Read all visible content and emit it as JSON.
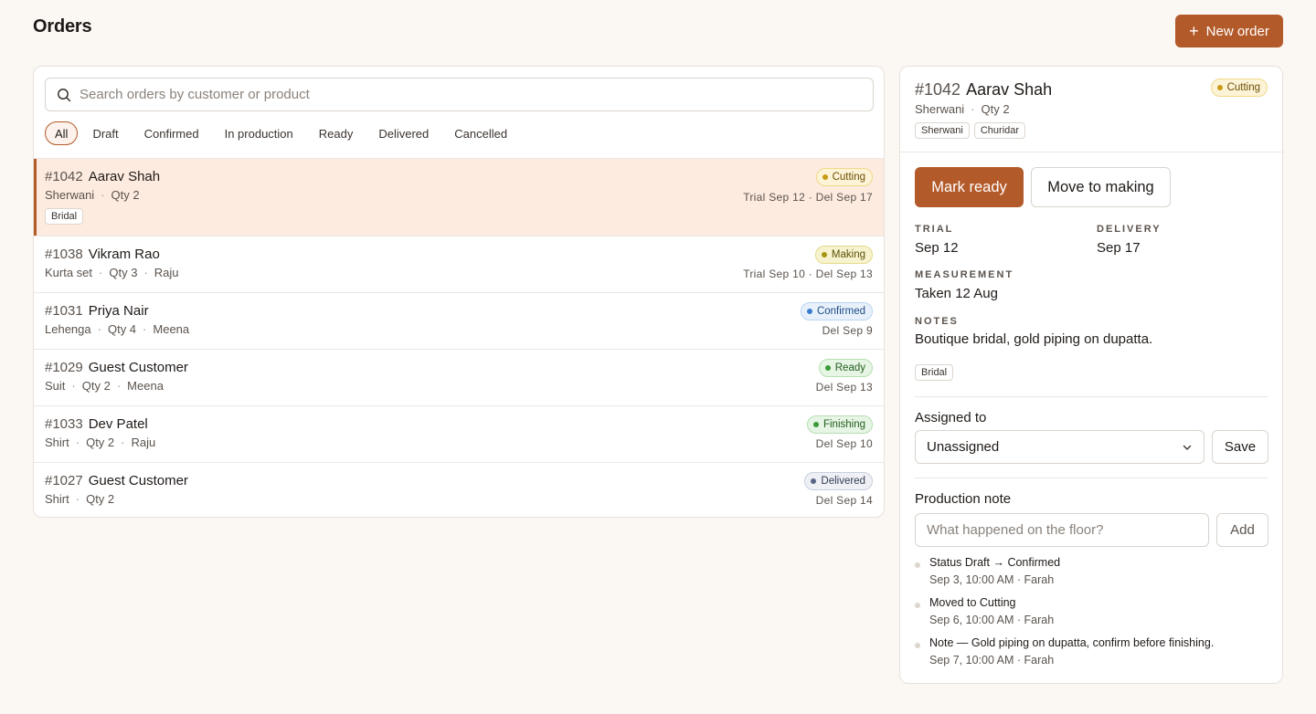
{
  "header": {
    "title": "Orders",
    "new_order_label": "New order"
  },
  "search": {
    "placeholder": "Search orders by customer or product"
  },
  "filters": [
    "All",
    "Draft",
    "Confirmed",
    "In production",
    "Ready",
    "Delivered",
    "Cancelled"
  ],
  "active_filter": "All",
  "orders": [
    {
      "num": "#1042",
      "name": "Aarav Shah",
      "sub": [
        "Sherwani",
        "Qty 2"
      ],
      "tag": "Bridal",
      "status": "Cutting",
      "dates": "Trial Sep 12 · Del Sep 17",
      "selected": true
    },
    {
      "num": "#1038",
      "name": "Vikram Rao",
      "sub": [
        "Kurta set",
        "Qty 3",
        "Raju"
      ],
      "tag": "",
      "status": "Making",
      "dates": "Trial Sep 10 · Del Sep 13",
      "selected": false
    },
    {
      "num": "#1031",
      "name": "Priya Nair",
      "sub": [
        "Lehenga",
        "Qty 4",
        "Meena"
      ],
      "tag": "",
      "status": "Confirmed",
      "dates": "Del Sep 9",
      "selected": false
    },
    {
      "num": "#1029",
      "name": "Guest Customer",
      "sub": [
        "Suit",
        "Qty 2",
        "Meena"
      ],
      "tag": "",
      "status": "Ready",
      "dates": "Del Sep 13",
      "selected": false
    },
    {
      "num": "#1033",
      "name": "Dev Patel",
      "sub": [
        "Shirt",
        "Qty 2",
        "Raju"
      ],
      "tag": "",
      "status": "Finishing",
      "dates": "Del Sep 10",
      "selected": false
    },
    {
      "num": "#1027",
      "name": "Guest Customer",
      "sub": [
        "Shirt",
        "Qty 2"
      ],
      "tag": "",
      "status": "Delivered",
      "dates": "Del Sep 14",
      "selected": false
    }
  ],
  "status_colors": {
    "Cutting": {
      "bg": "#fdf3d6",
      "border": "#f0d98a",
      "dot": "#c99a14",
      "text": "#6b4f06"
    },
    "Making": {
      "bg": "#f7f3cf",
      "border": "#e4da8a",
      "dot": "#a69511",
      "text": "#5b5106"
    },
    "Confirmed": {
      "bg": "#e8f1fb",
      "border": "#b9d3f0",
      "dot": "#3b7bd0",
      "text": "#1d4c86"
    },
    "Ready": {
      "bg": "#e6f5e4",
      "border": "#b7deb2",
      "dot": "#3c9a36",
      "text": "#245d1f"
    },
    "Finishing": {
      "bg": "#e6f5e4",
      "border": "#b7deb2",
      "dot": "#3c9a36",
      "text": "#245d1f"
    },
    "Delivered": {
      "bg": "#eef0f6",
      "border": "#c9cfdf",
      "dot": "#5a6685",
      "text": "#343c53"
    }
  },
  "detail": {
    "num": "#1042",
    "name": "Aarav Shah",
    "status": "Cutting",
    "sub": [
      "Sherwani",
      "Qty 2"
    ],
    "tags": [
      "Sherwani",
      "Churidar"
    ],
    "mark_ready_label": "Mark ready",
    "move_label": "Move to making",
    "trial_label": "TRIAL",
    "trial_value": "Sep 12",
    "delivery_label": "DELIVERY",
    "delivery_value": "Sep 17",
    "measurement_label": "MEASUREMENT",
    "measurement_value": "Taken 12 Aug",
    "notes_label": "NOTES",
    "notes_value": "Boutique bridal, gold piping on dupatta.",
    "notes_tag": "Bridal",
    "assigned_label": "Assigned to",
    "assigned_value": "Unassigned",
    "save_label": "Save",
    "production_label": "Production note",
    "note_placeholder": "What happened on the floor?",
    "add_label": "Add",
    "activity": [
      {
        "title": "Status Draft → Confirmed",
        "meta": "Sep 3, 10:00 AM · Farah"
      },
      {
        "title": "Moved to Cutting",
        "meta": "Sep 6, 10:00 AM · Farah"
      },
      {
        "title": "Note — Gold piping on dupatta, confirm before finishing.",
        "meta": "Sep 7, 10:00 AM · Farah"
      }
    ]
  }
}
